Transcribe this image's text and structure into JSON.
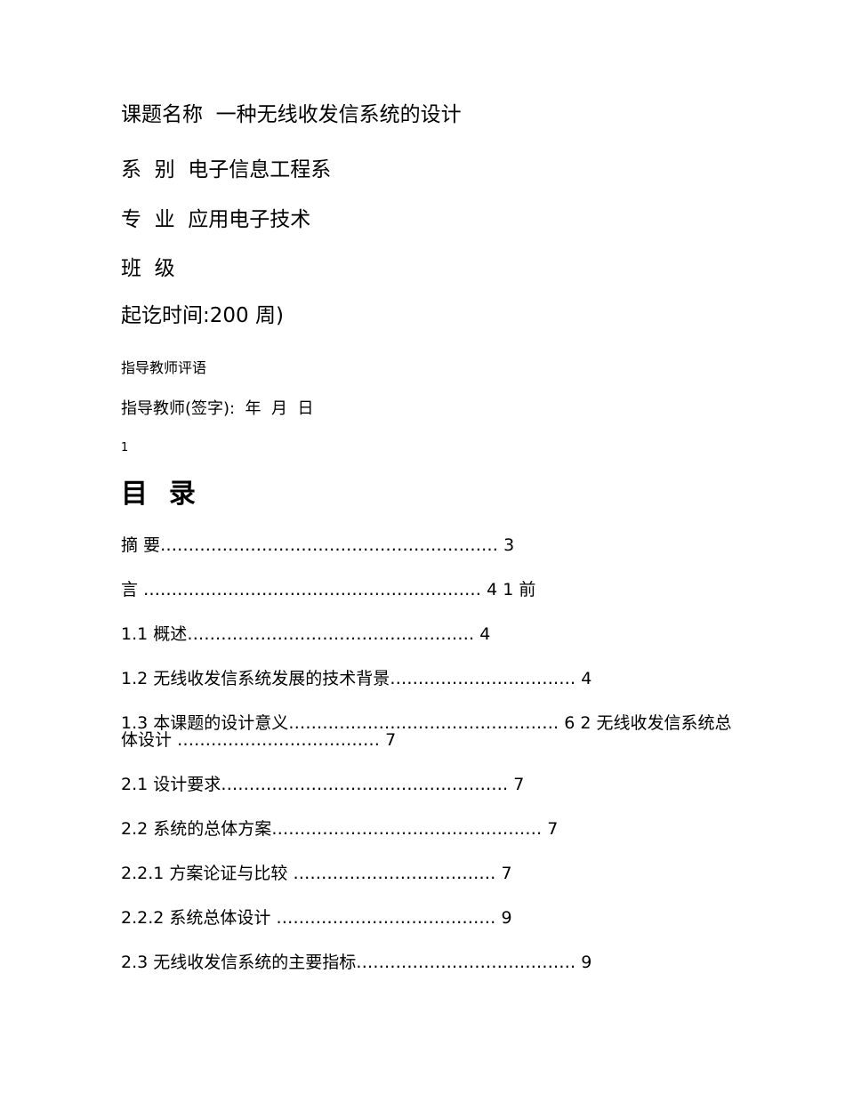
{
  "document": {
    "cover": {
      "lines": [
        "课题名称  一种无线收发信系统的设计",
        "系  别  电子信息工程系",
        "专  业  应用电子技术",
        "班  级",
        "起讫时间:200 周)"
      ],
      "advisor_comment_label": "指导教师评语",
      "advisor_signature_line": "指导教师(签字):  年  月  日",
      "page_number": "1"
    },
    "toc": {
      "title": "目  录",
      "entries": [
        "摘 要…………………………………………………… 3",
        "言 …………………………………………………… 4 1 前",
        "1.1 概述…………………………………………… 4",
        "1.2 无线收发信系统发展的技术背景…………………………… 4",
        "1.3 本课题的设计意义………………………………………… 6 2 无线收发信系统总体设计 ……………………………… 7",
        "2.1 设计要求…………………………………………… 7",
        "2.2 系统的总体方案………………………………………… 7",
        "2.2.1 方案论证与比较 ……………………………… 7",
        "2.2.2 系统总体设计 ………………………………… 9",
        "2.3 无线收发信系统的主要指标………………………………… 9"
      ]
    }
  }
}
